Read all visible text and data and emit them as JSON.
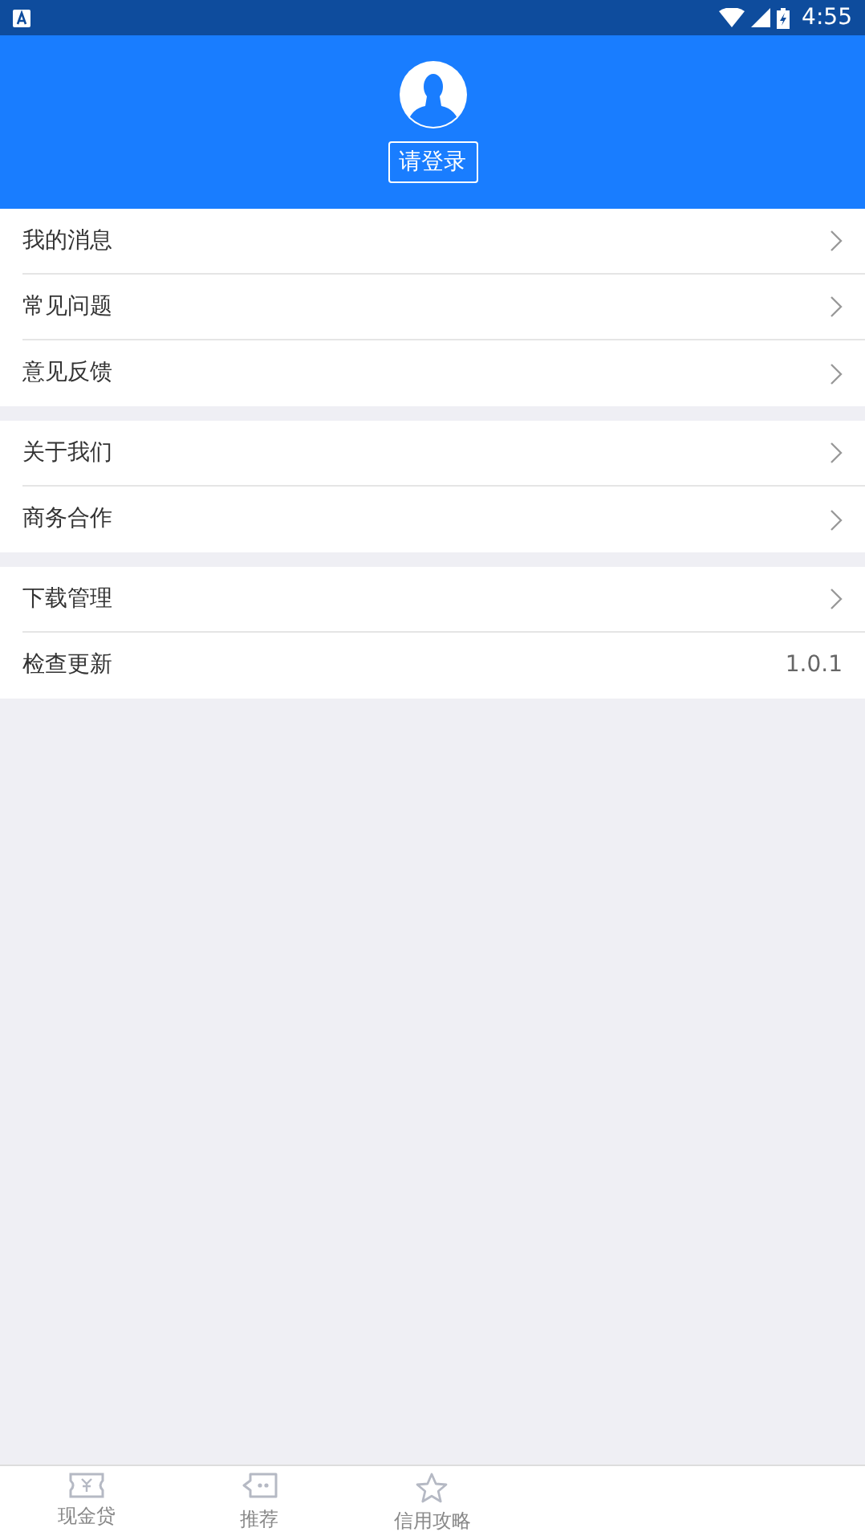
{
  "status_bar": {
    "time": "4:55"
  },
  "header": {
    "login_button": "请登录"
  },
  "groups": [
    {
      "items": [
        {
          "label": "我的消息",
          "kind": "link"
        },
        {
          "label": "常见问题",
          "kind": "link"
        },
        {
          "label": "意见反馈",
          "kind": "link"
        }
      ]
    },
    {
      "items": [
        {
          "label": "关于我们",
          "kind": "link"
        },
        {
          "label": "商务合作",
          "kind": "link"
        }
      ]
    },
    {
      "items": [
        {
          "label": "下载管理",
          "kind": "link"
        },
        {
          "label": "检查更新",
          "kind": "value",
          "value": "1.0.1"
        }
      ]
    }
  ],
  "tabs": [
    {
      "label": "现金贷",
      "kind": "ticket",
      "selected": false
    },
    {
      "label": "推荐",
      "kind": "chat",
      "selected": false
    },
    {
      "label": "信用攻略",
      "kind": "star",
      "selected": false
    }
  ]
}
